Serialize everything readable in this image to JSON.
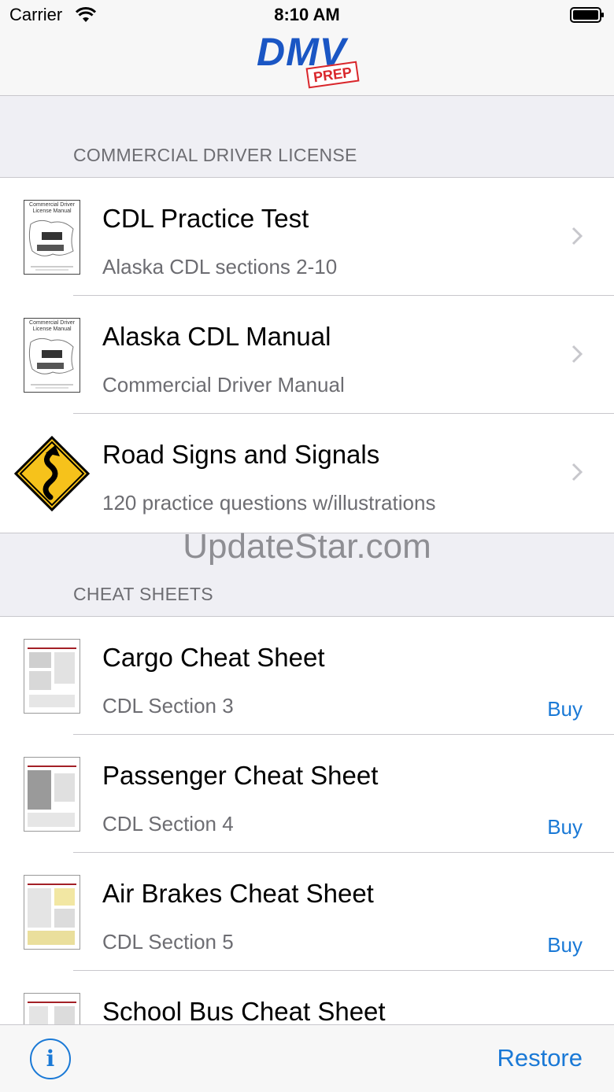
{
  "status": {
    "carrier": "Carrier",
    "time": "8:10 AM"
  },
  "logo": {
    "main": "DMV",
    "badge": "PREP"
  },
  "sections": [
    {
      "header": "COMMERCIAL DRIVER LICENSE",
      "rows": [
        {
          "title": "CDL Practice Test",
          "subtitle": "Alaska CDL sections 2-10",
          "thumb_label": "Commercial Driver License Manual"
        },
        {
          "title": "Alaska CDL Manual",
          "subtitle": "Commercial Driver Manual",
          "thumb_label": "Commercial Driver License Manual"
        },
        {
          "title": "Road Signs and Signals",
          "subtitle": "120 practice questions w/illustrations"
        }
      ]
    },
    {
      "header": "CHEAT SHEETS",
      "rows": [
        {
          "title": "Cargo Cheat Sheet",
          "subtitle": "CDL Section 3",
          "action": "Buy"
        },
        {
          "title": "Passenger Cheat Sheet",
          "subtitle": "CDL Section 4",
          "action": "Buy"
        },
        {
          "title": "Air Brakes Cheat Sheet",
          "subtitle": "CDL Section 5",
          "action": "Buy"
        },
        {
          "title": "School Bus Cheat Sheet"
        }
      ]
    }
  ],
  "watermark": "UpdateStar.com",
  "toolbar": {
    "info_label": "i",
    "restore_label": "Restore"
  },
  "colors": {
    "accent": "#1a79d6",
    "logo_blue": "#1a56c4",
    "logo_red": "#d9262b",
    "sign_yellow": "#f6c21b"
  },
  "icons": [
    "wifi-icon",
    "battery-icon",
    "chevron-right-icon",
    "winding-road-sign-icon",
    "info-icon"
  ]
}
